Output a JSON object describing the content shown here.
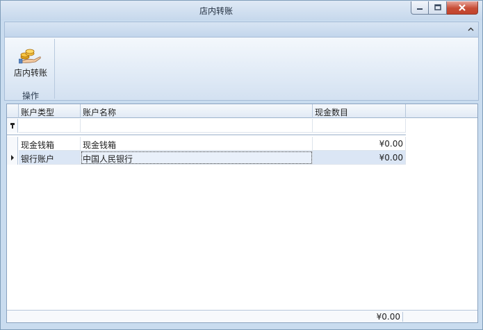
{
  "window": {
    "title": "店内转账"
  },
  "ribbon": {
    "buttons": [
      {
        "label": "店内转账",
        "icon": "coins-hand-icon"
      }
    ],
    "group_label": "操作"
  },
  "grid": {
    "columns": [
      "账户类型",
      "账户名称",
      "现金数目"
    ],
    "filter_row": [
      "",
      "",
      ""
    ],
    "rows": [
      {
        "type": "现金钱箱",
        "name": "现金钱箱",
        "amount": "¥0.00"
      },
      {
        "type": "银行账户",
        "name": "中国人民银行",
        "amount": "¥0.00"
      }
    ],
    "footer_total": "¥0.00",
    "selected_row": 1
  }
}
